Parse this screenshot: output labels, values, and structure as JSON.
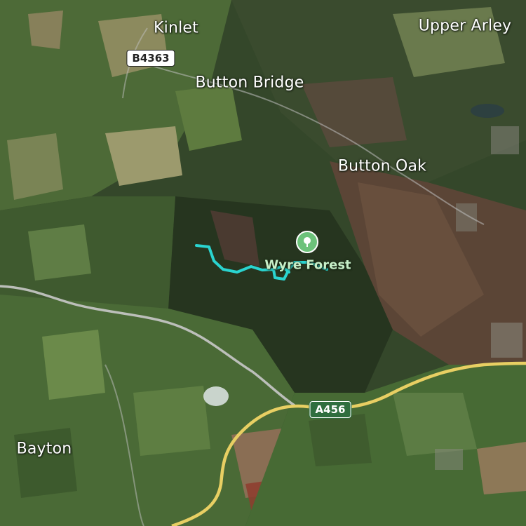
{
  "map": {
    "places": [
      {
        "id": "kinlet",
        "name": "Kinlet"
      },
      {
        "id": "upper-arley",
        "name": "Upper Arley"
      },
      {
        "id": "button-bridge",
        "name": "Button Bridge"
      },
      {
        "id": "button-oak",
        "name": "Button Oak"
      },
      {
        "id": "bayton",
        "name": "Bayton"
      }
    ],
    "roads": {
      "b4363": "B4363",
      "a456": "A456"
    },
    "poi": {
      "name": "Wyre Forest",
      "icon": "tree-icon",
      "color": "#6cc27a"
    },
    "route": {
      "color": "#2ad4d0"
    },
    "road_colors": {
      "major": "#e8cf63",
      "minor": "#c9c9c9"
    }
  }
}
